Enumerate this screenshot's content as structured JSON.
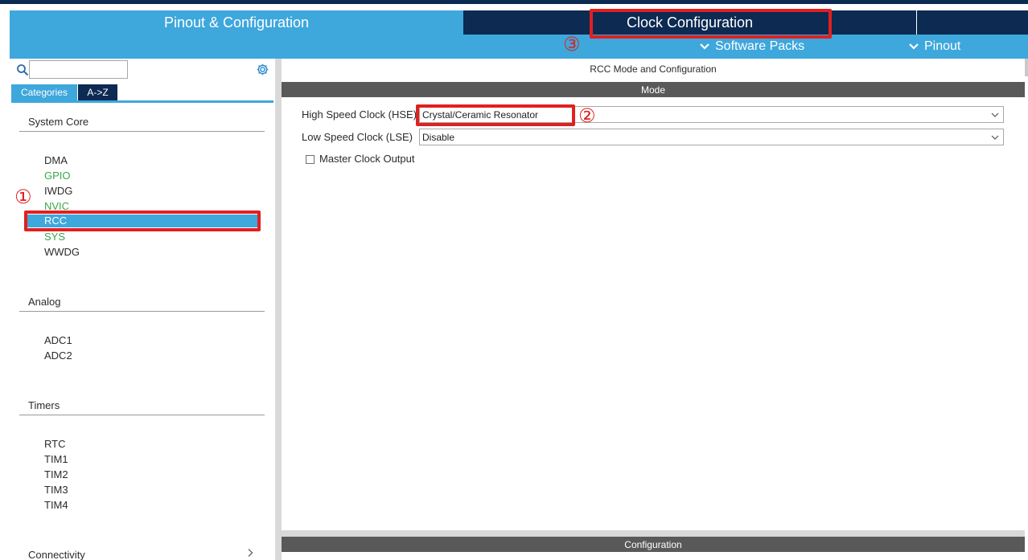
{
  "header": {
    "tabs": [
      {
        "label": "Pinout & Configuration",
        "active": true
      },
      {
        "label": "Clock Configuration",
        "active": false
      }
    ],
    "subbar": {
      "software_packs": "Software Packs",
      "pinout": "Pinout"
    }
  },
  "sidebar": {
    "search": {
      "value": "",
      "placeholder": ""
    },
    "view_tabs": [
      "Categories",
      "A->Z"
    ],
    "sections": [
      {
        "title": "System Core",
        "items": [
          "DMA",
          "GPIO",
          "IWDG",
          "NVIC",
          "RCC",
          "SYS",
          "WWDG"
        ]
      },
      {
        "title": "Analog",
        "items": [
          "ADC1",
          "ADC2"
        ]
      },
      {
        "title": "Timers",
        "items": [
          "RTC",
          "TIM1",
          "TIM2",
          "TIM3",
          "TIM4"
        ]
      },
      {
        "title": "Connectivity",
        "items": []
      }
    ],
    "selected_item": "RCC"
  },
  "main": {
    "title": "RCC Mode and Configuration",
    "mode_header": "Mode",
    "fields": [
      {
        "label": "High Speed Clock (HSE)",
        "value": "Crystal/Ceramic Resonator"
      },
      {
        "label": "Low Speed Clock (LSE)",
        "value": "Disable"
      }
    ],
    "checkbox": {
      "label": "Master Clock Output",
      "checked": false
    },
    "config_header": "Configuration"
  },
  "annotations": {
    "marker1": "①",
    "marker2": "②",
    "marker3": "③"
  },
  "colors": {
    "header_blue": "#3ea7dc",
    "navy": "#0c2a52",
    "gpio_green": "#3aa84a",
    "annotation_red": "#e02020"
  }
}
